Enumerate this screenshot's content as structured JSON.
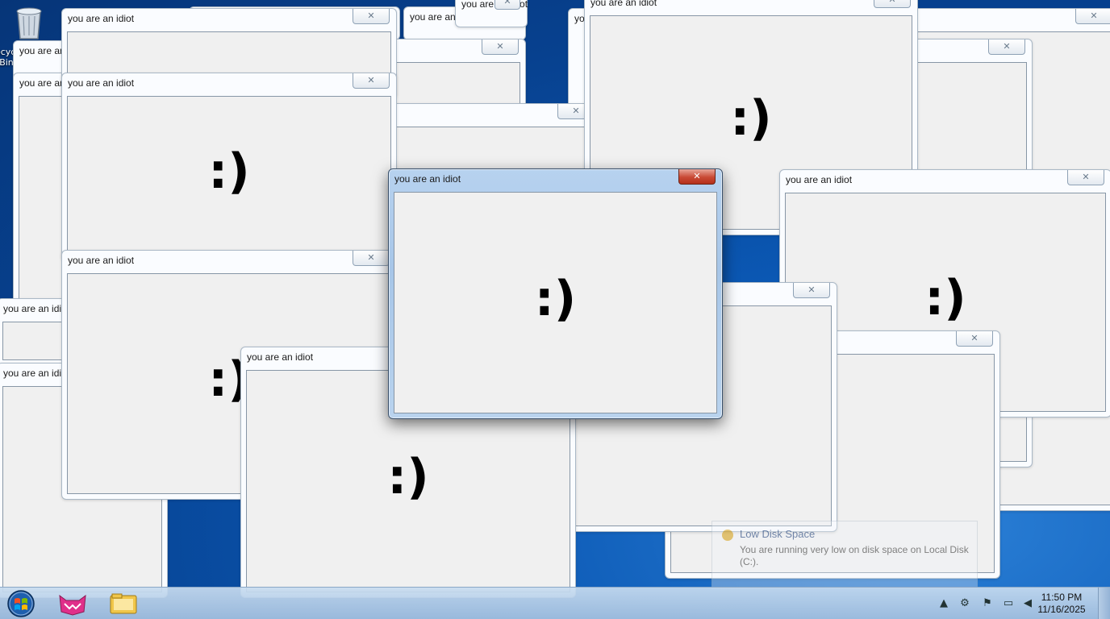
{
  "window_title": "you are an idiot",
  "smiley": ":)",
  "close_glyph": "✕",
  "taskbar": {
    "time": "11:50 PM",
    "date": "11/16/2025"
  },
  "notification": {
    "title": "Low Disk Space",
    "body": "You are running very low on disk space on Local Disk (C:)."
  },
  "desktop_icons": [
    "Recycle Bin"
  ],
  "icons": [
    "recycle-bin-icon",
    "start-orb-icon",
    "pink-cat-app-icon",
    "file-explorer-icon",
    "tray-arrow-icon",
    "network-icon",
    "action-center-icon",
    "display-icon",
    "volume-muted-icon"
  ],
  "colors": {
    "desktop": "#0b58b4",
    "active_close": "#c94a35",
    "window_frame": "#c6dcf3",
    "client": "#f0f0f0"
  }
}
